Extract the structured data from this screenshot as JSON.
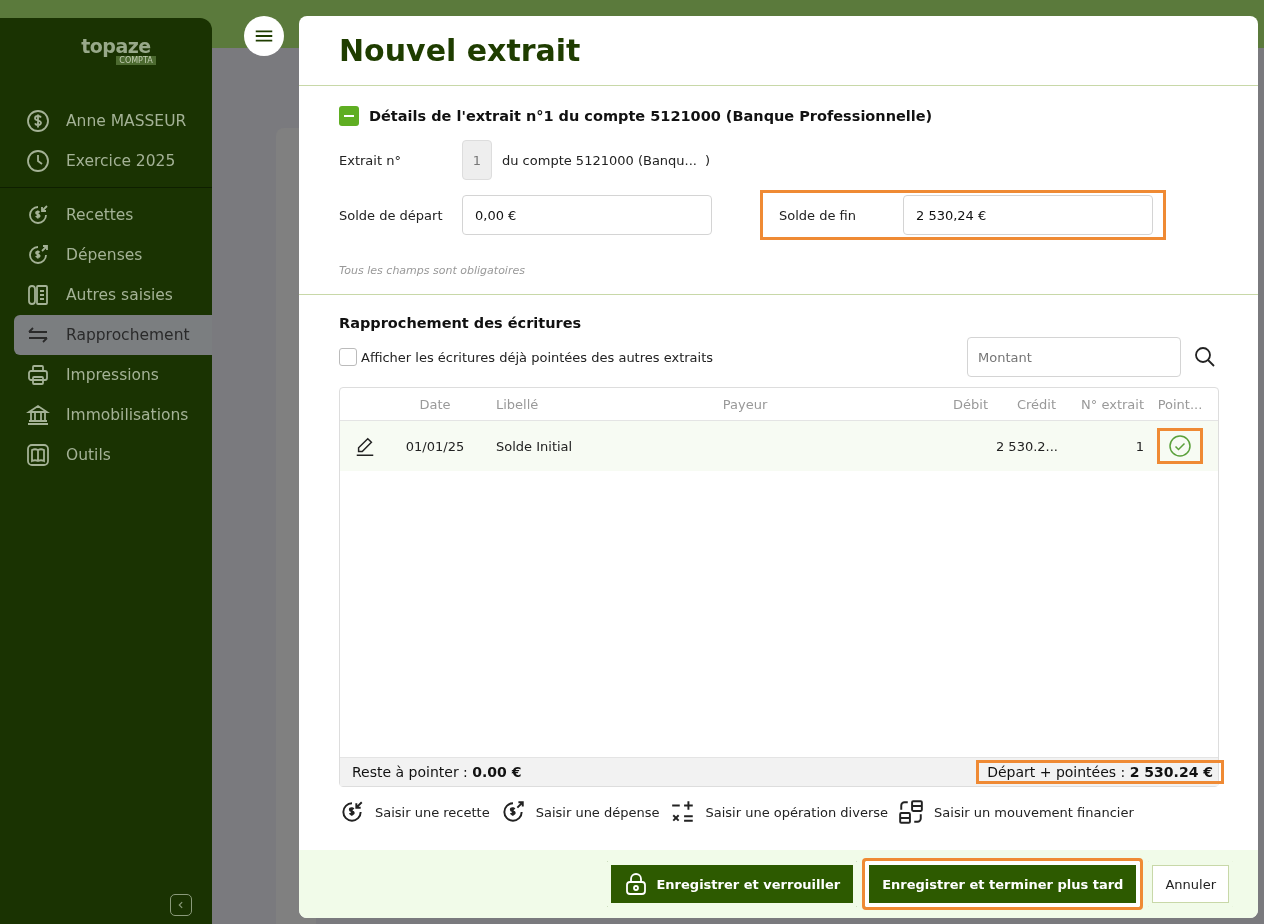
{
  "sidebar": {
    "logo": {
      "name": "topaze",
      "tag": "COMPTA"
    },
    "account_items": [
      {
        "kind": "dollar",
        "label": "Anne MASSEUR"
      },
      {
        "kind": "clock",
        "label": "Exercice 2025"
      }
    ],
    "items": [
      {
        "kind": "income",
        "label": "Recettes",
        "selected": false
      },
      {
        "kind": "expense",
        "label": "Dépenses",
        "selected": false
      },
      {
        "kind": "forms",
        "label": "Autres saisies",
        "selected": false
      },
      {
        "kind": "swap",
        "label": "Rapprochement",
        "selected": true
      },
      {
        "kind": "printer",
        "label": "Impressions",
        "selected": false
      },
      {
        "kind": "bank",
        "label": "Immobilisations",
        "selected": false
      },
      {
        "kind": "book",
        "label": "Outils",
        "selected": false
      }
    ]
  },
  "dialog": {
    "title": "Nouvel extrait",
    "details": {
      "heading": "Détails de l'extrait n°1 du compte 5121000 (Banque Professionnelle)",
      "expanded": true,
      "statement_label": "Extrait n°",
      "statement_number": "1",
      "account_text": "du compte 5121000 (Banqu...",
      "account_close": ")",
      "start_label": "Solde de départ",
      "start_value": "0,00 €",
      "end_label": "Solde de fin",
      "end_value": "2 530,24 €",
      "end_highlighted": true,
      "note": "Tous les champs sont obligatoires"
    },
    "reconcile": {
      "heading": "Rapprochement des écritures",
      "show_other": {
        "label": "Afficher les écritures déjà pointées des autres extraits",
        "checked": false
      },
      "search": {
        "placeholder": "Montant"
      },
      "columns": [
        "Date",
        "Libellé",
        "Payeur",
        "Débit",
        "Crédit",
        "N° extrait",
        "Point..."
      ],
      "rows": [
        {
          "date": "01/01/25",
          "label": "Solde Initial",
          "payer": "",
          "debit": "",
          "credit": "2 530.2...",
          "statement": "1",
          "pointed": true,
          "highlighted": true
        }
      ],
      "remaining": {
        "label": "Reste à pointer : ",
        "value": "0.00 €"
      },
      "total": {
        "label": "Départ + pointées : ",
        "value": "2 530.24 €",
        "highlighted": true
      }
    },
    "actions": [
      {
        "kind": "income",
        "label": "Saisir une recette"
      },
      {
        "kind": "expense",
        "label": "Saisir une dépense"
      },
      {
        "kind": "misc",
        "label": "Saisir une opération diverse"
      },
      {
        "kind": "transfer",
        "label": "Saisir un mouvement financier"
      }
    ],
    "buttons": [
      {
        "kind": "lock",
        "label": "Enregistrer et verrouiller",
        "highlighted": false
      },
      {
        "kind": "primary",
        "label": "Enregistrer et terminer plus tard",
        "highlighted": true
      },
      {
        "kind": "secondary",
        "label": "Annuler",
        "highlighted": false
      }
    ]
  }
}
